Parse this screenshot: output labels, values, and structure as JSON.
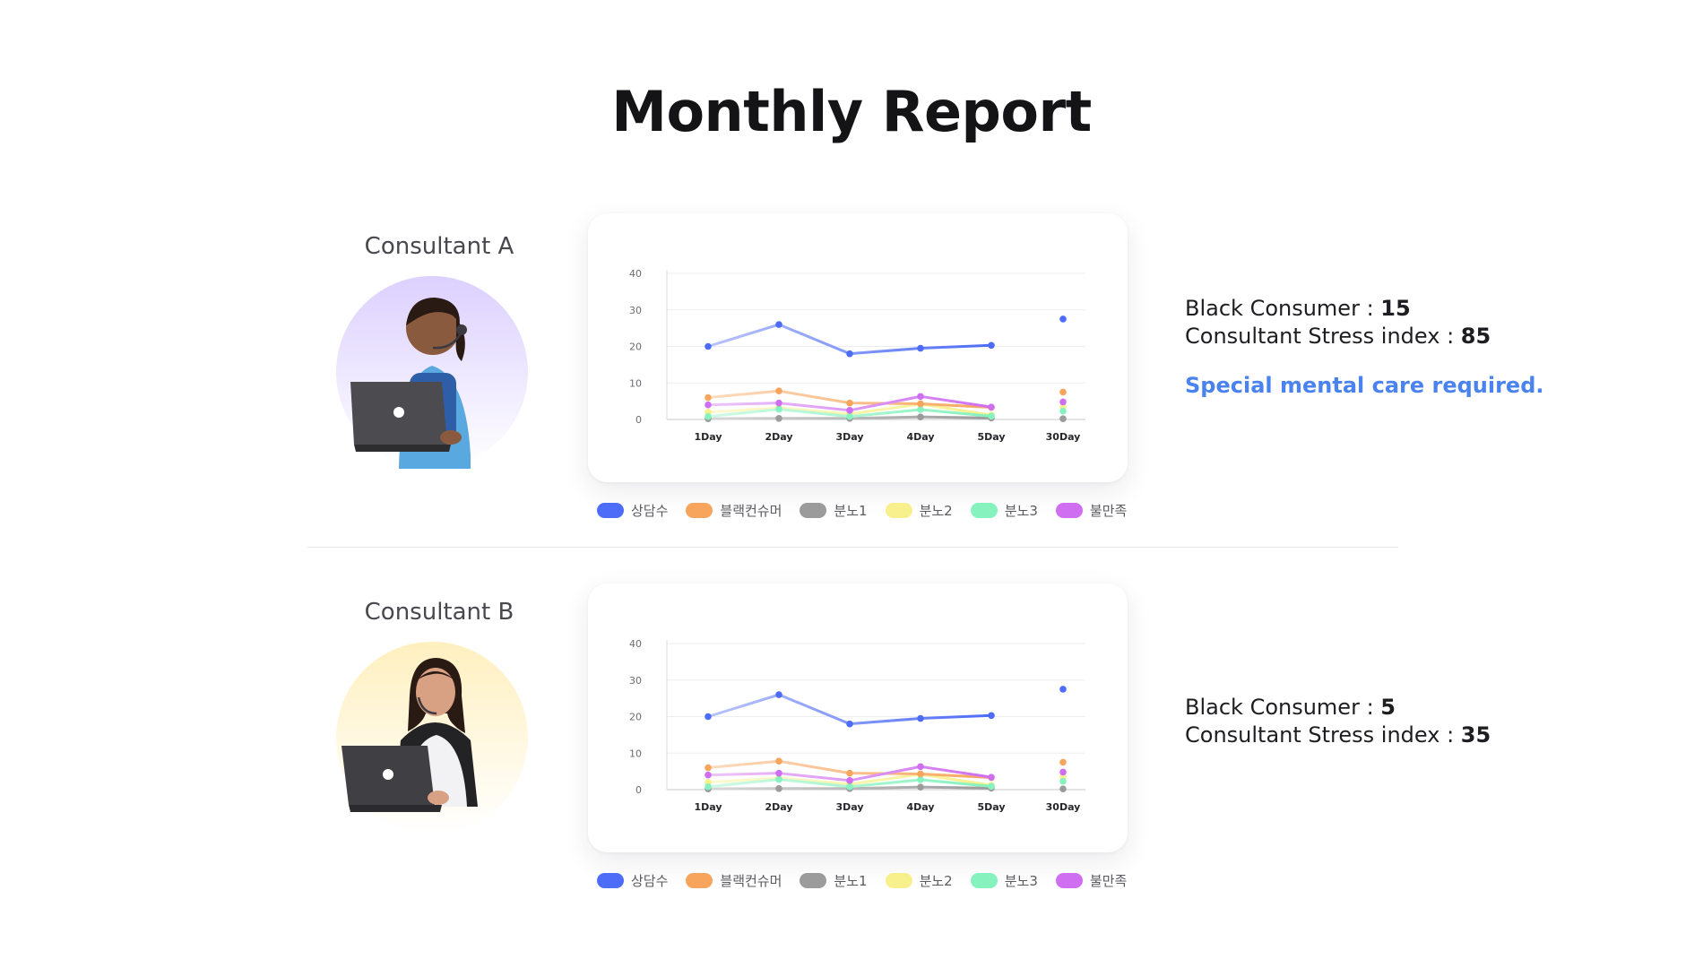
{
  "title": "Monthly Report",
  "legend": [
    {
      "label": "상담수",
      "color": "#4d6cf7"
    },
    {
      "label": "블랙컨슈머",
      "color": "#f7a55c"
    },
    {
      "label": "분노1",
      "color": "#9b9b9b"
    },
    {
      "label": "분노2",
      "color": "#f7f08c"
    },
    {
      "label": "분노3",
      "color": "#86f2bd"
    },
    {
      "label": "불만족",
      "color": "#cf6ef0"
    }
  ],
  "consultants": [
    {
      "name": "Consultant A",
      "avatar_bg": "#e6dcff",
      "black_consumer_label": "Black Consumer : ",
      "black_consumer_value": "15",
      "stress_label": "Consultant Stress index : ",
      "stress_value": "85",
      "note": "Special mental care required."
    },
    {
      "name": "Consultant B",
      "avatar_bg": "#fff2cc",
      "black_consumer_label": "Black Consumer : ",
      "black_consumer_value": "5",
      "stress_label": "Consultant Stress index : ",
      "stress_value": "35",
      "note": ""
    }
  ],
  "chart_data": [
    {
      "type": "line",
      "categories": [
        "1Day",
        "2Day",
        "3Day",
        "4Day",
        "5Day",
        "30Day"
      ],
      "y_ticks": [
        0,
        10,
        20,
        30,
        40
      ],
      "ylim": [
        0,
        40
      ],
      "grid": true,
      "series": [
        {
          "name": "상담수",
          "color": "#4d6cf7",
          "values": [
            20,
            26,
            18,
            19.5,
            20.3,
            27.5
          ]
        },
        {
          "name": "블랙컨슈머",
          "color": "#f7a55c",
          "values": [
            6,
            7.8,
            4.5,
            4.3,
            3.3,
            7.5
          ]
        },
        {
          "name": "분노1",
          "color": "#9b9b9b",
          "values": [
            0.2,
            0.3,
            0.3,
            0.7,
            0.4,
            0.2
          ]
        },
        {
          "name": "분노2",
          "color": "#f7f08c",
          "values": [
            2,
            3.2,
            1.5,
            4.2,
            1.2,
            3.5
          ]
        },
        {
          "name": "분노3",
          "color": "#86f2bd",
          "values": [
            0.8,
            2.8,
            0.8,
            2.7,
            0.9,
            2.3
          ]
        },
        {
          "name": "불만족",
          "color": "#cf6ef0",
          "values": [
            4,
            4.5,
            2.5,
            6.3,
            3.4,
            4.8
          ]
        }
      ]
    },
    {
      "type": "line",
      "categories": [
        "1Day",
        "2Day",
        "3Day",
        "4Day",
        "5Day",
        "30Day"
      ],
      "y_ticks": [
        0,
        10,
        20,
        30,
        40
      ],
      "ylim": [
        0,
        40
      ],
      "grid": true,
      "series": [
        {
          "name": "상담수",
          "color": "#4d6cf7",
          "values": [
            20,
            26,
            18,
            19.5,
            20.3,
            27.5
          ]
        },
        {
          "name": "블랙컨슈머",
          "color": "#f7a55c",
          "values": [
            6,
            7.8,
            4.5,
            4.3,
            3.3,
            7.5
          ]
        },
        {
          "name": "분노1",
          "color": "#9b9b9b",
          "values": [
            0.2,
            0.3,
            0.3,
            0.7,
            0.4,
            0.2
          ]
        },
        {
          "name": "분노2",
          "color": "#f7f08c",
          "values": [
            2,
            3.2,
            1.5,
            4.2,
            1.2,
            3.5
          ]
        },
        {
          "name": "분노3",
          "color": "#86f2bd",
          "values": [
            0.8,
            2.8,
            0.8,
            2.7,
            0.9,
            2.3
          ]
        },
        {
          "name": "불만족",
          "color": "#cf6ef0",
          "values": [
            4,
            4.5,
            2.5,
            6.3,
            3.4,
            4.8
          ]
        }
      ]
    }
  ]
}
